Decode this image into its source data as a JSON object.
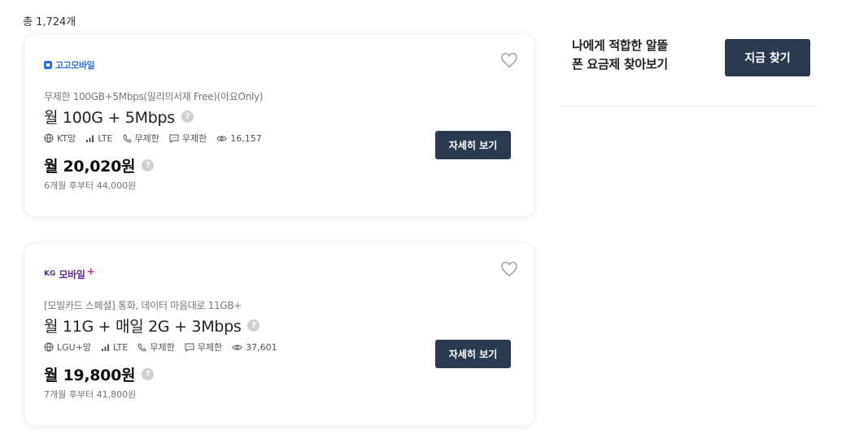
{
  "total_count": "총 1,724개",
  "plans": [
    {
      "brand": "고고모바일",
      "brand_style": "gogo",
      "subtitle": "무제한 100GB+5Mbps(밀리의서재 Free)(아요Only)",
      "name": "월 100G + 5Mbps",
      "network": "KT망",
      "type": "LTE",
      "calls": "무제한",
      "sms": "무제한",
      "views": "16,157",
      "price": "월 20,020원",
      "price_after": "6개월 후부터 44,000원",
      "detail_label": "자세히 보기"
    },
    {
      "brand_kg": "KG",
      "brand": "모바일",
      "brand_plus": "+",
      "brand_style": "kg",
      "subtitle": "[모빌카드 스페셜] 통화, 데이터 마음대로 11GB+",
      "name": "월 11G + 매일 2G + 3Mbps",
      "network": "LGU+망",
      "type": "LTE",
      "calls": "무제한",
      "sms": "무제한",
      "views": "37,601",
      "price": "월 19,800원",
      "price_after": "7개월 후부터 41,800원",
      "detail_label": "자세히 보기"
    }
  ],
  "promo": {
    "line1": "나에게 적합한 알뜰",
    "line2": "폰 요금제 찾아보기",
    "button_label": "지금 찾기"
  },
  "help_glyph": "?",
  "colors": {
    "button_bg": "#2c3a4f",
    "gogo_brand": "#2f6fe4",
    "kg_brand": "#5b2a86",
    "kg_plus": "#d6246e"
  },
  "icons": [
    "globe-icon",
    "signal-icon",
    "phone-icon",
    "message-icon",
    "eye-icon",
    "heart-icon",
    "help-icon"
  ]
}
